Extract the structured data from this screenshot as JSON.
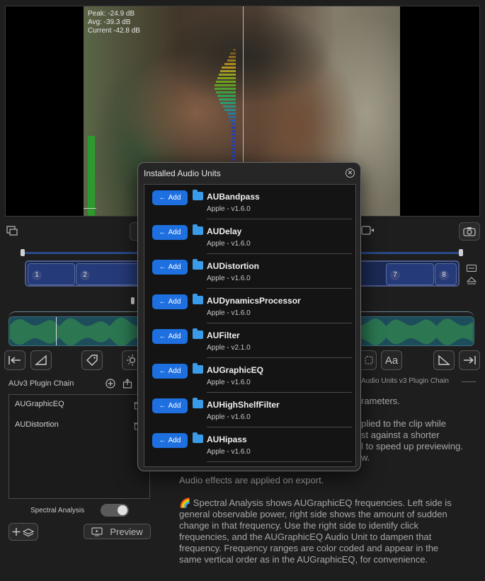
{
  "video": {
    "stats": {
      "peak": "Peak: -24.9 dB",
      "avg": "Avg: -39.3 dB",
      "current": "Current -42.8 dB"
    }
  },
  "clips": [
    "1",
    "2",
    "7",
    "8"
  ],
  "sidebar": {
    "chain_label": "AUv3 Plugin Chain",
    "chain_items": [
      "AUGraphicEQ",
      "AUDistortion"
    ],
    "spectral_label": "Spectral Analysis",
    "spectral_on": true,
    "preview_label": "Preview"
  },
  "right_panel": {
    "chain_title": "Audio Units v3 Plugin Chain",
    "text_lines": [
      "rameters.",
      "plied to the clip while",
      "st against a shorter",
      "l to speed up previewing.",
      "w."
    ],
    "export_note": "Audio effects are applied on export.",
    "spectral_help": [
      "🌈 Spectral Analysis shows AUGraphicEQ frequencies. Left side is",
      "general observable power, right side shows the amount of sudden",
      "change in that frequency. Use the right side to identify click",
      "frequencies, and the AUGraphicEQ Audio Unit to dampen that",
      "frequency. Frequency ranges are color coded and appear in the",
      "same vertical order as in the AUGraphicEQ, for convenience."
    ]
  },
  "modal": {
    "title": "Installed Audio Units",
    "add_label": "Add",
    "units": [
      {
        "name": "AUBandpass",
        "version": "Apple - v1.6.0"
      },
      {
        "name": "AUDelay",
        "version": "Apple - v1.6.0"
      },
      {
        "name": "AUDistortion",
        "version": "Apple - v1.6.0"
      },
      {
        "name": "AUDynamicsProcessor",
        "version": "Apple - v1.6.0"
      },
      {
        "name": "AUFilter",
        "version": "Apple - v2.1.0"
      },
      {
        "name": "AUGraphicEQ",
        "version": "Apple - v1.6.0"
      },
      {
        "name": "AUHighShelfFilter",
        "version": "Apple - v1.6.0"
      },
      {
        "name": "AUHipass",
        "version": "Apple - v1.6.0"
      }
    ]
  },
  "colors": {
    "accent": "#1e6fe0",
    "folder": "#3a9be8",
    "meter": "#2d9a2d"
  },
  "icons": [
    "picture-in-picture-icon",
    "camera-icon",
    "jump-start-icon",
    "fade-icon",
    "tag-icon",
    "brightness-icon",
    "text-icon",
    "jump-end-icon",
    "add-icon",
    "layers-icon",
    "trash-icon"
  ]
}
